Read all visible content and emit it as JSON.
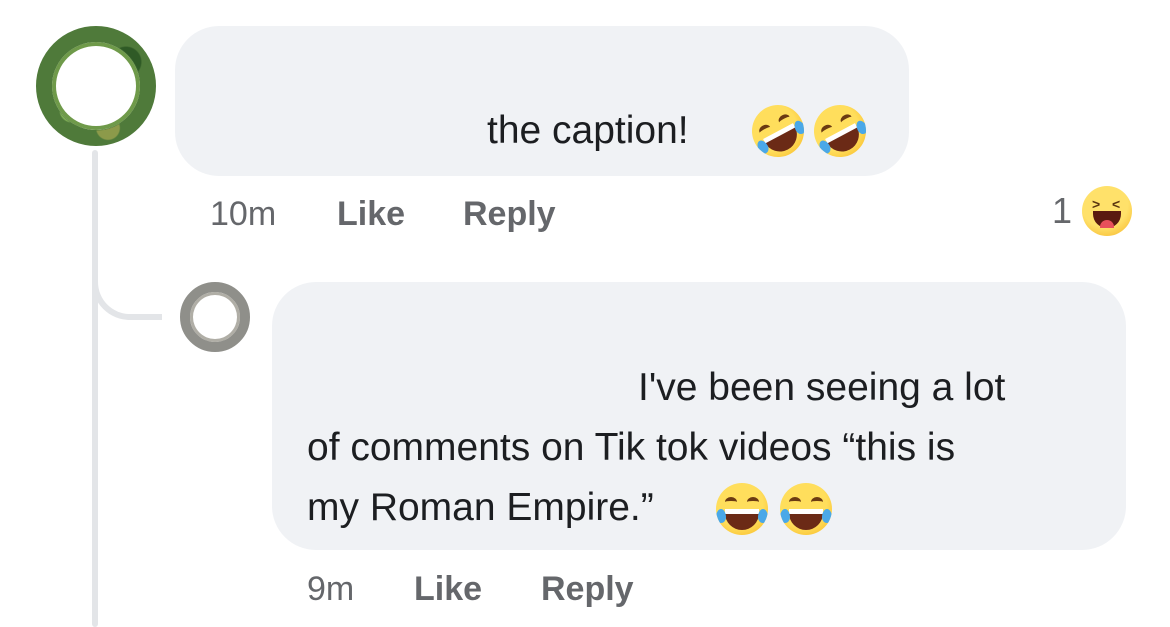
{
  "comments": [
    {
      "text_lines": [
        "the caption!"
      ],
      "emojis": [
        "rolling-on-floor-laughing-emoji",
        "rolling-on-floor-laughing-emoji"
      ],
      "time": "10m",
      "like_label": "Like",
      "reply_label": "Reply",
      "reaction": {
        "count": "1",
        "icon": "haha-reaction-icon"
      }
    },
    {
      "text_lines": [
        "I've been seeing a lot",
        "of comments on Tik tok videos “this is",
        "my Roman Empire.”"
      ],
      "emojis": [
        "face-with-tears-of-joy-emoji",
        "face-with-tears-of-joy-emoji"
      ],
      "time": "9m",
      "like_label": "Like",
      "reply_label": "Reply"
    }
  ],
  "colors": {
    "bubble_bg": "#f0f2f5",
    "meta_text": "#65676b",
    "body_text": "#1c1e21",
    "thread_line": "#e3e5e8"
  }
}
